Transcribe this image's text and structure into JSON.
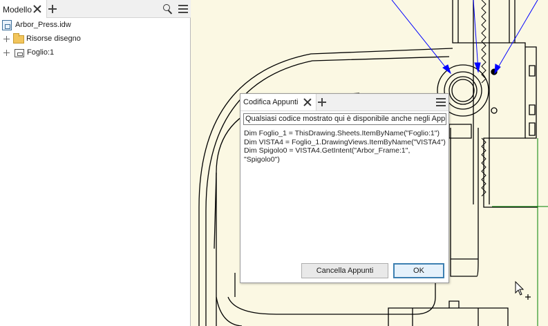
{
  "browser": {
    "tab_label": "Modello",
    "tree": [
      {
        "label": "Arbor_Press.idw",
        "icon": "drawing-file-icon"
      },
      {
        "label": "Risorse disegno",
        "icon": "folder-icon"
      },
      {
        "label": "Foglio:1",
        "icon": "sheet-icon"
      }
    ]
  },
  "dialog": {
    "tab_label": "Codifica Appunti",
    "info_text": "Qualsiasi codice mostrato qui è disponibile anche negli Appunti",
    "code_lines": [
      "Dim Foglio_1 = ThisDrawing.Sheets.ItemByName(\"Foglio:1\")",
      "Dim VISTA4 = Foglio_1.DrawingViews.ItemByName(\"VISTA4\")",
      "Dim Spigolo0 = VISTA4.GetIntent(\"Arbor_Frame:1\", \"Spigolo0\")"
    ],
    "clear_button": "Cancella Appunti",
    "ok_button": "OK"
  },
  "colors": {
    "canvas_background": "#fbf8e3",
    "leader_lines": "#0000ff",
    "sheet_border": "#008000",
    "geometry": "#000000"
  }
}
